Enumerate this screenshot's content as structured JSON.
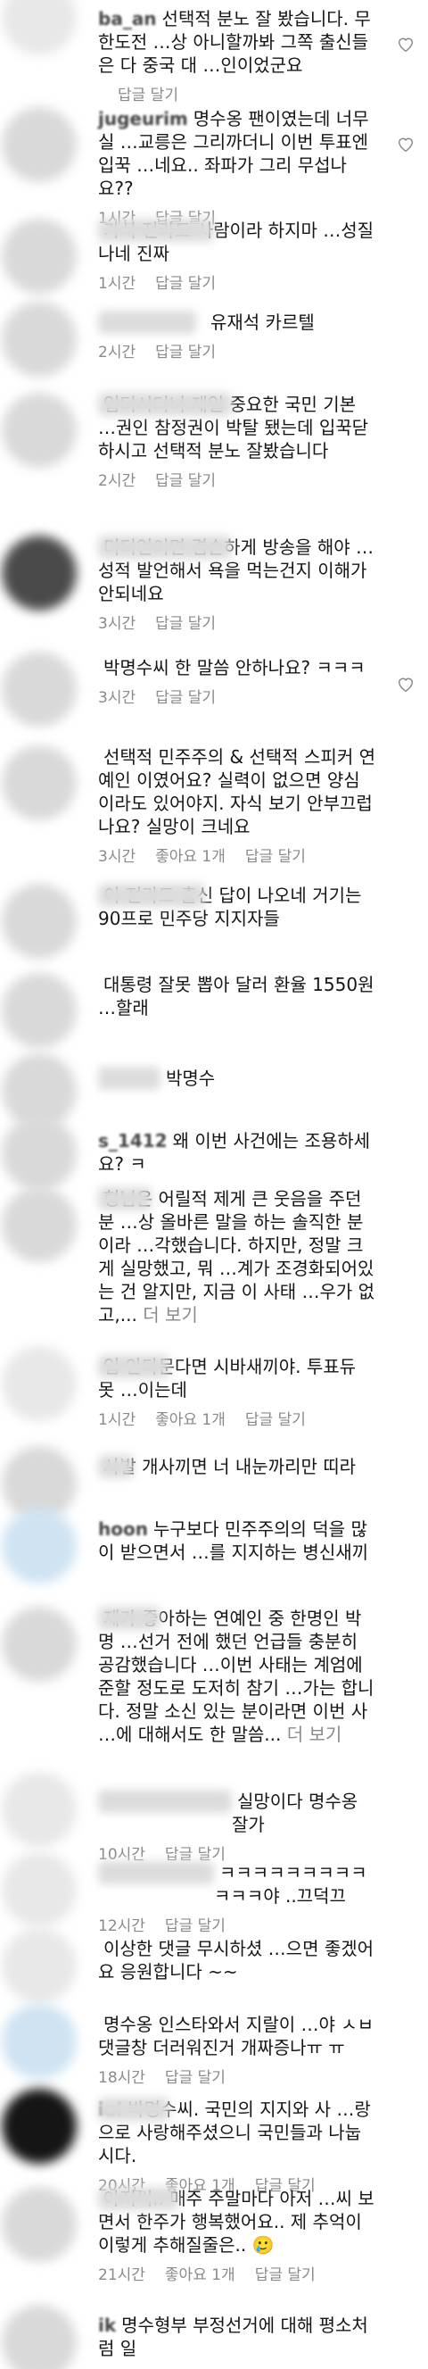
{
  "comments": [
    {
      "user": "ba_an",
      "text": "선택적 분노 잘 봤습니다. 무한도전 …상 아니할까봐 그쪽 출신들은 다 중국 대 …인이었군요",
      "time": "",
      "likes": "",
      "reply": "답글 달기"
    },
    {
      "user": "jugeurim",
      "text": "명수옹 팬이였는데 너무 실 …교릉은 그리까더니 이번 투표엔 입꾹 …네요.. 좌파가 그리 무섭나요??",
      "time": "1시간",
      "likes": "",
      "reply": "답글 달기"
    },
    {
      "user": "",
      "text": "가서 전라도 사람이라 하지마 …성질나네 진짜",
      "time": "1시간",
      "likes": "",
      "reply": "답글 달기"
    },
    {
      "user": "",
      "text": "유재석 카르텔",
      "time": "2시간",
      "likes": "",
      "reply": "답글 달기"
    },
    {
      "user": "",
      "text": "입터시더니 제일 중요한 국민 기본 …권인 참정권이 박탈 됐는데 입꾹닫 하시고 선택적 분노 잘봤습니다",
      "time": "2시간",
      "likes": "",
      "reply": "답글 달기"
    },
    {
      "user": "",
      "text": "미디언이면 겸손하게 방송을 해야 …성적 발언해서 욕을 먹는건지 이해가 안되네요",
      "time": "3시간",
      "likes": "",
      "reply": "답글 달기"
    },
    {
      "user": "",
      "text": "박명수씨 한 말씀 안하나요? ㅋㅋㅋ",
      "time": "3시간",
      "likes": "",
      "reply": "답글 달기"
    },
    {
      "user": "",
      "text": "선택적 민주주의 & 선택적 스피커 연예인 이였어요? 실력이 없으면 양심이라도 있어야지. 자식 보기 안부끄럽나요? 실망이 크네요",
      "time": "3시간",
      "likes": "좋아요 1개",
      "reply": "답글 달기"
    },
    {
      "user": "",
      "text": "이 전라도 출신 답이 나오네 거기는 90프로 민주당 지지자들",
      "time": "",
      "likes": "",
      "reply": ""
    },
    {
      "user": "",
      "text": "대통령 잘못 뽑아 달러 환율 1550원 …할래",
      "time": "",
      "likes": "",
      "reply": ""
    },
    {
      "user": "",
      "text": "박명수",
      "time": "",
      "likes": "",
      "reply": ""
    },
    {
      "user": "s_1412",
      "text": "왜 이번 사건에는 조용하세요? ㅋ",
      "time": "",
      "likes": "",
      "reply": ""
    },
    {
      "user": "",
      "text": "형님은 어릴적 제게 큰 웃음을 주던 분 …상 올바른 말을 하는 솔직한 분이라 …각했습니다. 하지만, 정말 크게 실망했고, 뭐 …계가 조경화되어있는 건 알지만, 지금 이 사태 …우가 없고,...",
      "more": "더 보기",
      "time": "",
      "likes": "",
      "reply": ""
    },
    {
      "user": "",
      "text": "입 안다문다면 시바새끼야. 투표듀 못 …이는데",
      "time": "1시간",
      "likes": "좋아요 1개",
      "reply": "답글 달기"
    },
    {
      "user": "",
      "text": "사발 개사끼면 너 내눈까리만 띠라",
      "time": "",
      "likes": "",
      "reply": ""
    },
    {
      "user": "hoon",
      "text": "누구보다 민주주의의 덕을 많이 받으면서 …를 지지하는 병신새끼",
      "time": "",
      "likes": "",
      "reply": ""
    },
    {
      "user": "",
      "text": "제가 좋아하는 연예인 중 한명인 박명 …선거 전에 했던 언급들 충분히 공감했습니다 …이번 사태는 계엄에 준할 정도로 도저히 참기 …가는 합니다. 정말 소신 있는 분이라면 이번 사 …에 대해서도 한 말씀...",
      "more": "더 보기",
      "time": "",
      "likes": "",
      "reply": ""
    },
    {
      "user": "",
      "text": "실망이다 명수옹 잘가",
      "time": "10시간",
      "likes": "",
      "reply": "답글 달기"
    },
    {
      "user": "",
      "text": "ㅋㅋㅋㅋㅋㅋㅋㅋㅋㅋㅋㅋ야 ..끄덕끄",
      "time": "12시간",
      "likes": "",
      "reply": "답글 달기"
    },
    {
      "user": "",
      "text": "이상한 댓글 무시하셨 …으면 좋겠어요 응원합니다 ~~",
      "time": "",
      "likes": "",
      "reply": ""
    },
    {
      "user": "",
      "text": "명수옹 인스타와서 지랄이 …야 ㅅㅂ 댓글창 더러워진거 개짜증나ㅠ ㅠ",
      "time": "18시간",
      "likes": "",
      "reply": "답글 달기"
    },
    {
      "user": "ial",
      "text": "박명수씨. 국민의 지지와 사 …랑으로 사랑해주셨으니 국민들과 나눕시다.",
      "time": "20시간",
      "likes": "좋아요 1개",
      "reply": "답글 달기"
    },
    {
      "user": "",
      "text": "아저씨.. 매주 주말마다 아저 …씨 보면서 한주가 행복했어요.. 제 추억이 이렇게 추해질줄은.. 🥲",
      "time": "21시간",
      "likes": "좋아요 1개",
      "reply": "답글 달기"
    },
    {
      "user": "ik",
      "text": "명수형부 부정선거에 대해 평소처럼 일",
      "time": "",
      "likes": "",
      "reply": ""
    }
  ]
}
